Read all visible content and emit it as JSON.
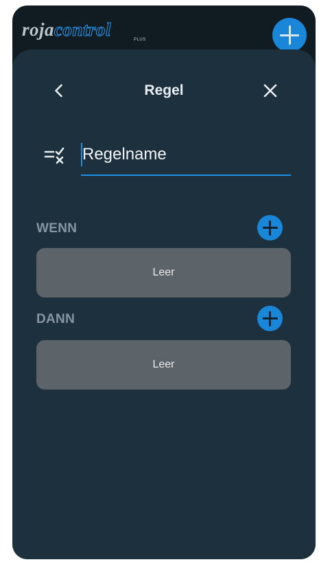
{
  "app": {
    "logo_part_a": "roja",
    "logo_part_b": "control",
    "logo_sub": "PLUS",
    "icons": {
      "top_add": "plus-icon",
      "back": "chevron-left-icon",
      "close": "close-icon",
      "name": "checklist-icon"
    },
    "colors": {
      "accent": "#1a86d8",
      "sheet": "#1d303d",
      "empty_box": "#5d6469"
    }
  },
  "header": {
    "title": "Regel"
  },
  "rule": {
    "name_value": "Regelname"
  },
  "sections": {
    "if": {
      "label": "WENN",
      "empty_text": "Leer"
    },
    "then": {
      "label": "DANN",
      "empty_text": "Leer"
    }
  }
}
